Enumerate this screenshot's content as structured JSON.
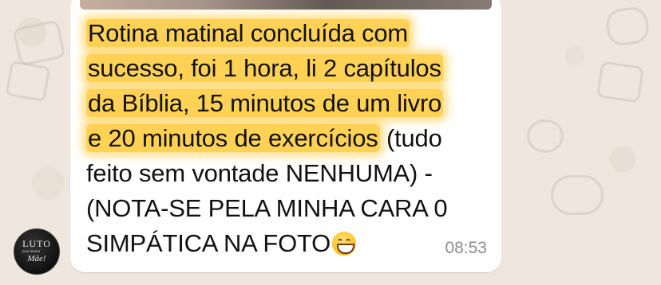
{
  "chat": {
    "message": {
      "lines": [
        {
          "highlighted": "Rotina matinal concluída com",
          "plain": ""
        },
        {
          "highlighted": "sucesso, foi 1 hora, li 2 capítulos",
          "plain": ""
        },
        {
          "highlighted": "da Bíblia, 15 minutos de um livro",
          "plain": ""
        },
        {
          "highlighted": "e 20 minutos de exercícios",
          "plain": " (tudo"
        },
        {
          "highlighted": "",
          "plain": "feito sem vontade NENHUMA) -"
        },
        {
          "highlighted": "",
          "plain": "(NOTA-SE PELA MINHA CARA 0"
        },
        {
          "highlighted": "",
          "plain": "SIMPÁTICA NA FOTO"
        }
      ],
      "emoji": "grinning-face-with-smiling-eyes",
      "time": "08:53"
    },
    "avatar": {
      "line1": "LUTO",
      "line2": "pela minha",
      "line3": "Mãe!"
    }
  },
  "colors": {
    "wallpaper": "#efe7dd",
    "bubble": "#ffffff",
    "highlight": "#ffc937",
    "text": "#111111",
    "timestamp": "#8c8c8c"
  }
}
